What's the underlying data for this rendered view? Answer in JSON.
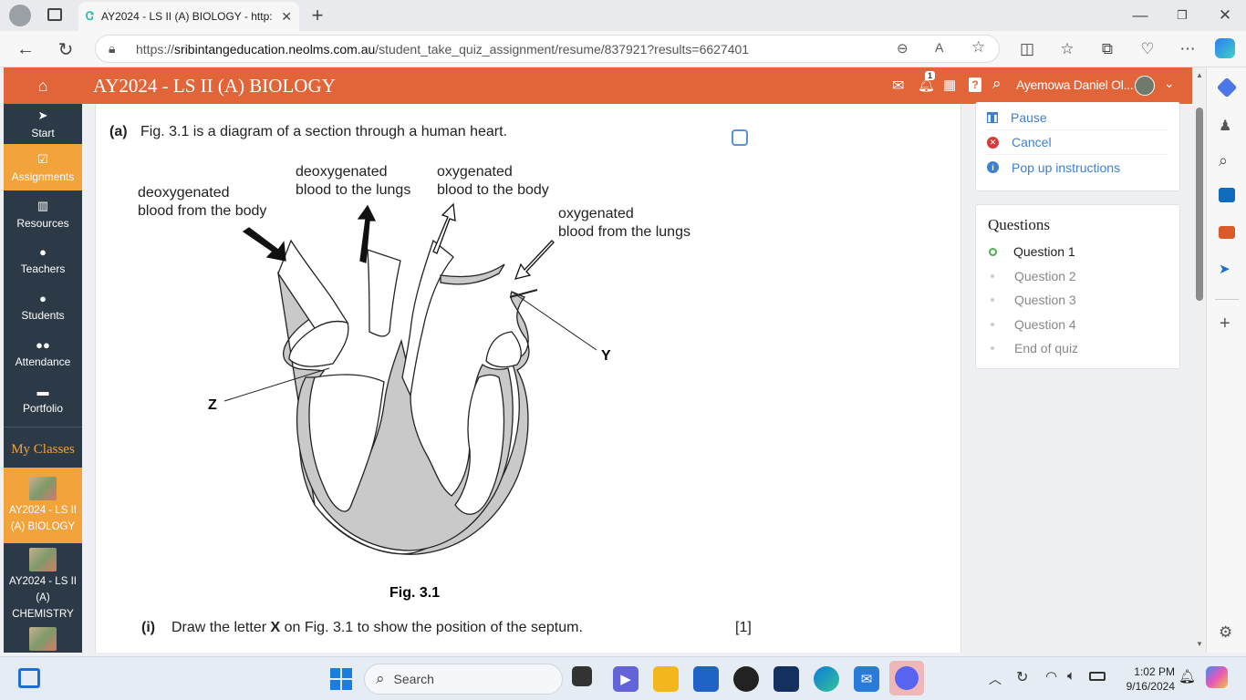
{
  "browser": {
    "tab_title": "AY2024 - LS II (A) BIOLOGY - http:",
    "url_prefix": "https://",
    "url_domain": "sribintangeducation.neolms.com.au",
    "url_path": "/student_take_quiz_assignment/resume/837921?results=6627401"
  },
  "header": {
    "title": "AY2024 - LS II (A) BIOLOGY",
    "notification_count": "1",
    "user_name": "Ayemowa Daniel Ol..."
  },
  "nav": {
    "items": [
      {
        "label": "Start",
        "icon": "send-icon"
      },
      {
        "label": "Assignments",
        "icon": "checkbox-icon"
      },
      {
        "label": "Resources",
        "icon": "books-icon"
      },
      {
        "label": "Teachers",
        "icon": "person-icon"
      },
      {
        "label": "Students",
        "icon": "person-icon"
      },
      {
        "label": "Attendance",
        "icon": "group-icon"
      },
      {
        "label": "Portfolio",
        "icon": "folder-icon"
      }
    ],
    "my_classes_label": "My Classes",
    "classes": [
      {
        "label": "AY2024 - LS II (A) BIOLOGY"
      },
      {
        "label": "AY2024 - LS II (A) CHEMISTRY"
      }
    ]
  },
  "question": {
    "part_label": "(a)",
    "part_text": "Fig. 3.1 is a diagram of a section through a human heart.",
    "figure_caption": "Fig. 3.1",
    "sub_label": "(i)",
    "sub_text_before": "Draw the letter ",
    "sub_text_bold": "X",
    "sub_text_after": " on Fig. 3.1 to show the position of the septum.",
    "marks": "[1]",
    "diagram": {
      "label_deox_from_body_1": "deoxygenated",
      "label_deox_from_body_2": "blood from the body",
      "label_deox_to_lungs_1": "deoxygenated",
      "label_deox_to_lungs_2": "blood to the lungs",
      "label_ox_to_body_1": "oxygenated",
      "label_ox_to_body_2": "blood to the body",
      "label_ox_from_lungs_1": "oxygenated",
      "label_ox_from_lungs_2": "blood from the lungs",
      "letter_y": "Y",
      "letter_z": "Z"
    }
  },
  "controls": {
    "pause": "Pause",
    "cancel": "Cancel",
    "popup": "Pop up instructions"
  },
  "questions_panel": {
    "heading": "Questions",
    "items": [
      "Question 1",
      "Question 2",
      "Question 3",
      "Question 4",
      "End of quiz"
    ]
  },
  "taskbar": {
    "search_placeholder": "Search",
    "time": "1:02 PM",
    "date": "9/16/2024"
  },
  "colors": {
    "header": "#e2653a",
    "nav": "#2c3a48",
    "nav_active": "#f3a33c",
    "link": "#3d7fd0"
  }
}
